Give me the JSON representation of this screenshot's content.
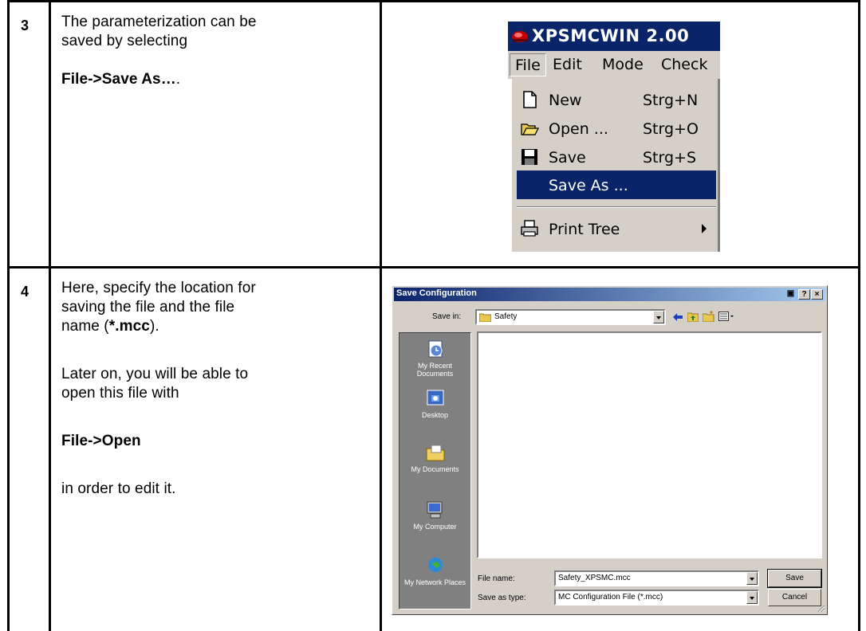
{
  "rows": [
    {
      "number": "3",
      "text_line1": "The parameterization can be",
      "text_line2": "saved by selecting",
      "text_bold": "File->Save As…",
      "text_bold_tail": "."
    },
    {
      "number": "4",
      "text_line1": "Here, specify the location for",
      "text_line2": "saving the file and the file",
      "text_line3_pre": "name (",
      "text_line3_bold": "*.mcc",
      "text_line3_post": ").",
      "text_line4": "Later on, you will be able to",
      "text_line5": "open this file with",
      "text_bold": "File->Open",
      "text_line6": "in order to edit it."
    }
  ],
  "menu_window": {
    "title": "XPSMCWIN 2.00",
    "menubar": [
      "File",
      "Edit",
      "Mode",
      "Check"
    ],
    "items": [
      {
        "label": "New",
        "accel": "Strg+N",
        "icon": "new-document-icon"
      },
      {
        "label": "Open ...",
        "accel": "Strg+O",
        "icon": "open-folder-icon"
      },
      {
        "label": "Save",
        "accel": "Strg+S",
        "icon": "floppy-disk-icon"
      },
      {
        "label": "Save As ...",
        "accel": "",
        "icon": "",
        "selected": true
      },
      {
        "label": "Print Tree",
        "accel": "",
        "icon": "printer-icon",
        "submenu": true
      }
    ]
  },
  "dialog": {
    "title": "Save Configuration",
    "save_in_label": "Save in:",
    "save_in_value": "Safety",
    "places": [
      "My Recent Documents",
      "Desktop",
      "My Documents",
      "My Computer",
      "My Network Places"
    ],
    "file_name_label": "File name:",
    "file_name_value": "Safety_XPSMC.mcc",
    "save_as_type_label": "Save as type:",
    "save_as_type_value": "MC Configuration File (*.mcc)",
    "save_button": "Save",
    "cancel_button": "Cancel",
    "help_button": "?",
    "close_button": "×"
  },
  "colors": {
    "title_active": "#0a246a",
    "face": "#d4d0c8",
    "highlight": "#0a246a"
  }
}
